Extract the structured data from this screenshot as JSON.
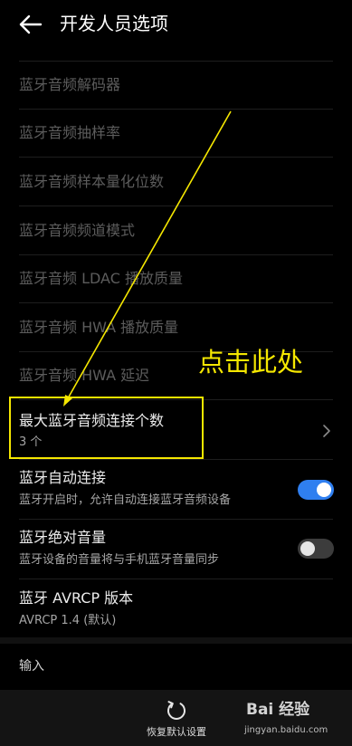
{
  "header": {
    "title": "开发人员选项",
    "back_icon": "arrow-left-icon"
  },
  "settings": {
    "codec": "蓝牙音频解码器",
    "sample_rate": "蓝牙音频抽样率",
    "bits_per_sample": "蓝牙音频样本量化位数",
    "channel_mode": "蓝牙音频频道模式",
    "ldac_quality": "蓝牙音频 LDAC 播放质量",
    "hwa_quality": "蓝牙音频 HWA 播放质量",
    "hwa_latency": "蓝牙音频 HWA 延迟",
    "max_connections": {
      "label": "最大蓝牙音频连接个数",
      "value": "3 个"
    },
    "auto_connect": {
      "label": "蓝牙自动连接",
      "summary": "蓝牙开启时，允许自动连接蓝牙音频设备",
      "enabled": true
    },
    "absolute_volume": {
      "label": "蓝牙绝对音量",
      "summary": "蓝牙设备的音量将与手机蓝牙音量同步",
      "enabled": false
    },
    "avrcp_version": {
      "label": "蓝牙 AVRCP 版本",
      "value": "AVRCP 1.4 (默认)"
    }
  },
  "input_section": {
    "title": "输入"
  },
  "bottom_bar": {
    "reset_label": "恢复默认设置",
    "reset_icon": "reset-icon"
  },
  "annotation": {
    "text": "点击此处",
    "color": "#f5e700"
  },
  "watermark": {
    "brand": "Bai 经验",
    "url": "jingyan.baidu.com"
  },
  "colors": {
    "background": "#000000",
    "toggle_on": "#2f7ff0",
    "toggle_off": "#3c3c3c",
    "disabled_text": "#5c5c5c"
  }
}
